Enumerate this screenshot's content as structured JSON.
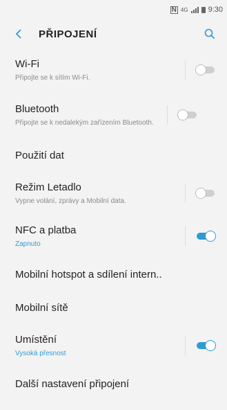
{
  "status_bar": {
    "time": "9:30"
  },
  "app_bar": {
    "title": "PŘIPOJENÍ"
  },
  "colors": {
    "accent": "#2f9bd6",
    "background": "#f3f3f3"
  },
  "items": [
    {
      "label": "Wi-Fi",
      "sub": "Připojte se k sítím Wi-Fi.",
      "toggle": "off"
    },
    {
      "label": "Bluetooth",
      "sub": "Připojte se k nedalekým zařízením Bluetooth.",
      "toggle": "off"
    },
    {
      "label": "Použití dat"
    },
    {
      "label": "Režim Letadlo",
      "sub": "Vypne volání, zprávy a Mobilní data.",
      "toggle": "off"
    },
    {
      "label": "NFC a platba",
      "sub": "Zapnuto",
      "toggle": "on"
    },
    {
      "label": "Mobilní hotspot a sdílení intern.."
    },
    {
      "label": "Mobilní sítě"
    },
    {
      "label": "Umístění",
      "sub": "Vysoká přesnost",
      "toggle": "on"
    },
    {
      "label": "Další nastavení připojení"
    }
  ]
}
